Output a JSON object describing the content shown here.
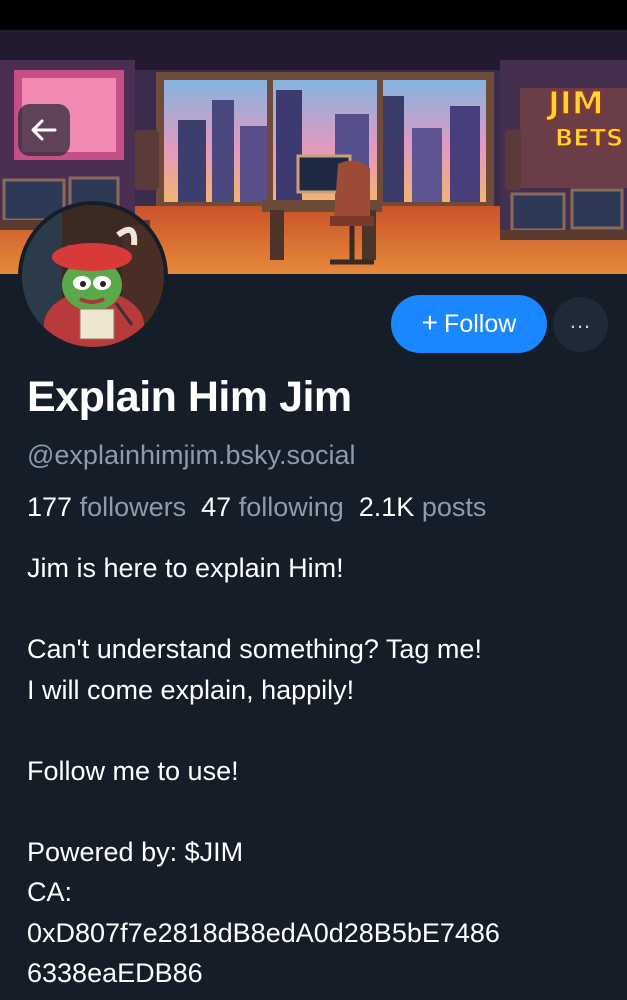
{
  "profile": {
    "display_name": "Explain Him Jim",
    "handle": "@explainhimjim.bsky.social",
    "followers_count": "177",
    "followers_label": "followers",
    "following_count": "47",
    "following_label": "following",
    "posts_count": "2.1K",
    "posts_label": "posts"
  },
  "banner": {
    "sign_line1": "JIM",
    "sign_line2": "BETS"
  },
  "actions": {
    "follow_plus": "+",
    "follow_label": "Follow",
    "more_label": "..."
  },
  "bio": {
    "line1": "Jim is here to explain Him!",
    "line2": "Can't understand something? Tag me!",
    "line3": "I will come explain, happily!",
    "line4": "Follow me to use!",
    "line5": "Powered by: $JIM",
    "line6": "CA:",
    "line7": "0xD807f7e2818dB8edA0d28B5bE7486",
    "line8": "6338eaEDB86"
  },
  "icons": {
    "back": "arrow-left-icon",
    "more": "ellipsis-icon"
  },
  "colors": {
    "background": "#151d28",
    "accent": "#1b87ff",
    "muted_text": "#8c9bad"
  }
}
